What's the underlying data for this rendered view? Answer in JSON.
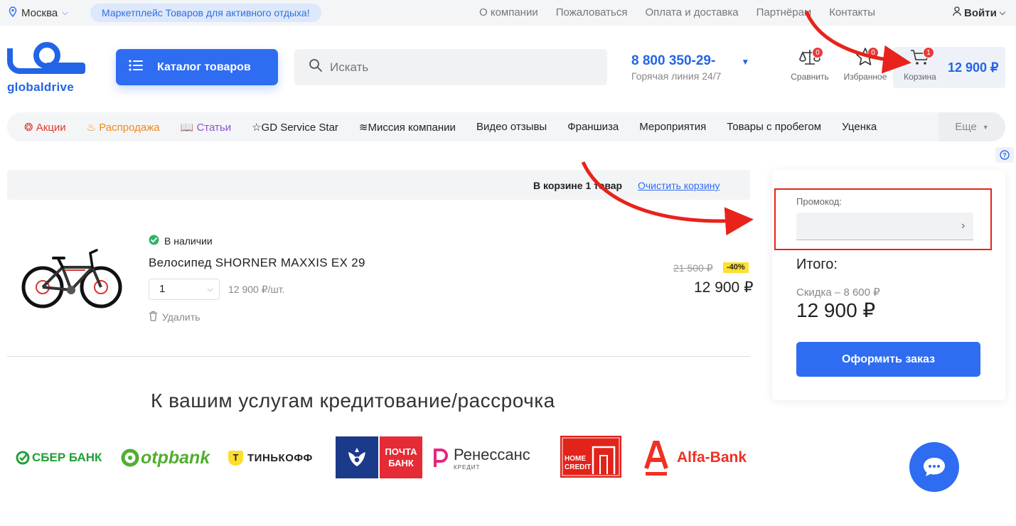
{
  "topbar": {
    "city": "Москва",
    "marketplace_label": "Маркетплейс Товаров для активного отдыха!",
    "links": [
      "О компании",
      "Пожаловаться",
      "Оплата и доставка",
      "Партнёрам",
      "Контакты"
    ],
    "login_label": "Войти"
  },
  "header": {
    "logo_text": "globaldrive",
    "catalog_button": "Каталог товаров",
    "search_placeholder": "Искать",
    "phone": "8 800 350-29-",
    "phone_sub": "Горячая линия 24/7",
    "compare_label": "Сравнить",
    "compare_count": "0",
    "favorites_label": "Избранное",
    "favorites_count": "0",
    "cart_label": "Корзина",
    "cart_count": "1",
    "cart_total": "12 900 ₽"
  },
  "nav": {
    "items": [
      {
        "label": "Акции",
        "icon": "percent-icon",
        "color": "#e23b2e"
      },
      {
        "label": "Распродажа",
        "icon": "fire-icon",
        "color": "#f08a1c"
      },
      {
        "label": "Статьи",
        "icon": "book-icon",
        "color": "#8b52d6"
      },
      {
        "label": "GD Service Star",
        "icon": "star-outline-icon",
        "color": "#222222"
      },
      {
        "label": "Миссия компании",
        "icon": "mission-icon",
        "color": "#222222"
      },
      {
        "label": "Видео отзывы"
      },
      {
        "label": "Франшиза"
      },
      {
        "label": "Мероприятия"
      },
      {
        "label": "Товары с пробегом"
      },
      {
        "label": "Уценка"
      }
    ],
    "more_label": "Еще"
  },
  "cart": {
    "count_text": "В корзине 1 товар",
    "clear_label": "Очистить корзину",
    "item": {
      "stock": "В наличии",
      "name": "Велосипед SHORNER MAXXIS EX 29",
      "quantity": "1",
      "unit_price": "12 900 ₽/шт.",
      "delete_label": "Удалить",
      "old_price": "21 500 ₽",
      "discount": "-40%",
      "price": "12 900 ₽"
    }
  },
  "credit": {
    "title": "К вашим услугам кредитование/рассрочка",
    "banks": [
      "СБЕР БАНК",
      "otpbank",
      "ТИНЬКОФФ",
      "ПОЧТА БАНК",
      "Ренессанс",
      "КРЕДИТ",
      "HOME CREDIT",
      "Alfa-Bank"
    ]
  },
  "summary": {
    "promo_label": "Промокод:",
    "promo_value": "",
    "itogo_label": "Итого:",
    "discount_text": "Скидка – 8 600 ₽",
    "total": "12 900 ₽",
    "order_button": "Оформить заказ"
  },
  "colors": {
    "accent": "#2e6cf2",
    "annotation": "#e8231b",
    "discount_badge": "#ffe030"
  }
}
